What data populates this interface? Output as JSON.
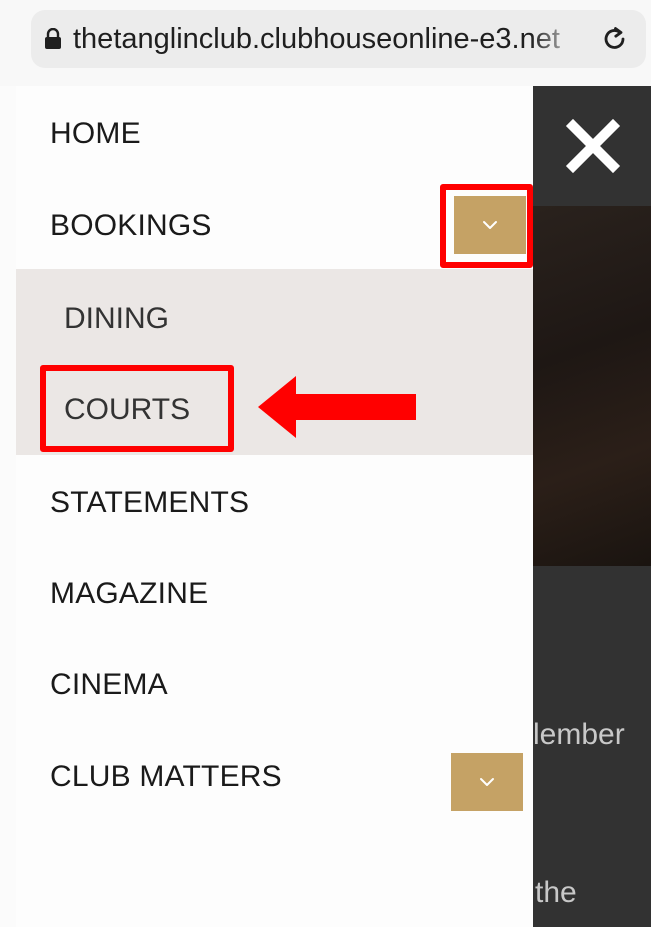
{
  "browser": {
    "url": "thetanglinclub.clubhouseonline-e3.net",
    "lock_icon": "lock-icon",
    "reload_icon": "reload-icon"
  },
  "menu": {
    "items": [
      {
        "label": "HOME"
      },
      {
        "label": "BOOKINGS"
      },
      {
        "label": "STATEMENTS"
      },
      {
        "label": "MAGAZINE"
      },
      {
        "label": "CINEMA"
      },
      {
        "label": "CLUB MATTERS"
      }
    ],
    "bookings_submenu": [
      {
        "label": "DINING"
      },
      {
        "label": "COURTS"
      }
    ],
    "toggle_icon": "chevron-down-icon"
  },
  "background": {
    "peek_text_1": "lember",
    "peek_text_2": "the",
    "close_icon": "close-icon"
  },
  "colors": {
    "toggle_gold": "#c5a265",
    "submenu_bg": "#ebe7e5",
    "annotation_red": "#ff0000",
    "backdrop": "#323232"
  }
}
